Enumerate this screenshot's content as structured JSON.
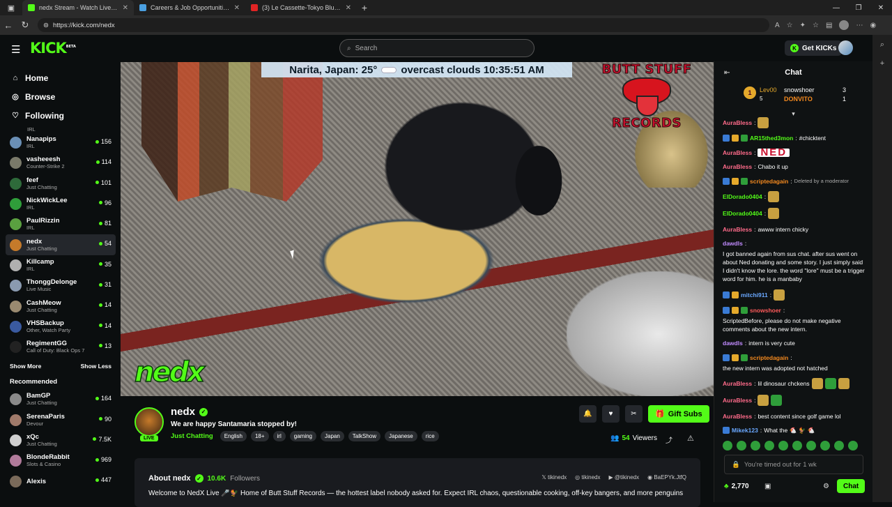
{
  "browser": {
    "tabs": [
      {
        "title": "nedx Stream - Watch Live on Kick",
        "active": true,
        "color": "#53fc18"
      },
      {
        "title": "Careers & Job Opportunities - Ear",
        "active": false,
        "color": "#4a9fe0"
      },
      {
        "title": "(3) Le Cassette-Tokyo Blues - You",
        "active": false,
        "color": "#e02424"
      }
    ],
    "url": "https://kick.com/nedx"
  },
  "header": {
    "logo": "KICK",
    "logo_sup": "BETA",
    "search_placeholder": "Search",
    "get_kicks": "Get KICKs"
  },
  "sidebar": {
    "nav": [
      {
        "label": "Home",
        "icon": "home-icon"
      },
      {
        "label": "Browse",
        "icon": "compass-icon"
      },
      {
        "label": "Following",
        "icon": "heart-icon"
      }
    ],
    "partial_category": "IRL",
    "following": [
      {
        "name": "Nanapips",
        "category": "IRL",
        "viewers": "156",
        "color": "#6a8fb5"
      },
      {
        "name": "vasheeesh",
        "category": "Counter-Strike 2",
        "viewers": "114",
        "color": "#7a7a6a"
      },
      {
        "name": "feef",
        "category": "Just Chatting",
        "viewers": "101",
        "color": "#2e6a3a"
      },
      {
        "name": "NickWickLee",
        "category": "IRL",
        "viewers": "96",
        "color": "#2f9e3a"
      },
      {
        "name": "PaulRizzin",
        "category": "IRL",
        "viewers": "81",
        "color": "#5aa040"
      },
      {
        "name": "nedx",
        "category": "Just Chatting",
        "viewers": "54",
        "color": "#c57a2a",
        "selected": true
      },
      {
        "name": "Killcamp",
        "category": "IRL",
        "viewers": "35",
        "color": "#b0b0b0"
      },
      {
        "name": "ThonggDelonge",
        "category": "Live Music",
        "viewers": "31",
        "color": "#8a9ab0"
      },
      {
        "name": "CashMeow",
        "category": "Just Chatting",
        "viewers": "14",
        "color": "#9a8a70"
      },
      {
        "name": "VHSBackup",
        "category": "Other, Watch Party",
        "viewers": "14",
        "color": "#3a5aa0"
      },
      {
        "name": "RegimentGG",
        "category": "Call of Duty: Black Ops 7",
        "viewers": "13",
        "color": "#222222"
      }
    ],
    "show_more": "Show More",
    "show_less": "Show Less",
    "recommended_label": "Recommended",
    "recommended": [
      {
        "name": "BamGP",
        "category": "Just Chatting",
        "viewers": "164",
        "color": "#8a8a8a"
      },
      {
        "name": "SerenaParis",
        "category": "Devour",
        "viewers": "90",
        "color": "#a07a6a"
      },
      {
        "name": "xQc",
        "category": "Just Chatting",
        "viewers": "7.5K",
        "color": "#cfcfcf"
      },
      {
        "name": "BlondeRabbit",
        "category": "Slots & Casino",
        "viewers": "969",
        "color": "#b07a9a"
      },
      {
        "name": "Alexis",
        "category": "",
        "viewers": "447",
        "color": "#7a6a5a"
      }
    ]
  },
  "video": {
    "weather": "Narita, Japan: 25°",
    "weather2": "overcast clouds 10:35:51 AM",
    "overlay_top": "BUTT STUFF",
    "overlay_bottom": "RECORDS",
    "watermark": "nedx"
  },
  "channel": {
    "name": "nedx",
    "live": "LIVE",
    "title": "We are happy Santamaria stopped by!",
    "category": "Just Chatting",
    "tags": [
      "English",
      "18+",
      "irl",
      "gaming",
      "Japan",
      "TalkShow",
      "Japanese",
      "rice"
    ],
    "gift_subs": "Gift Subs",
    "viewers": "54",
    "viewers_label": "Viewers"
  },
  "about": {
    "title": "About nedx",
    "followers": "10.6K",
    "followers_label": "Followers",
    "socials": [
      "tikinedx",
      "tikinedx",
      "@tikinedx",
      "BaEPYk.JtfQ"
    ],
    "description": "Welcome to NedX Live 🎤🐓 Home of Butt Stuff Records — the hottest label nobody asked for. Expect IRL chaos, questionable cooking, off-key bangers, and more penguins"
  },
  "chat": {
    "title": "Chat",
    "leaderboard": {
      "first_name": "Lev00",
      "first_count": "5",
      "second_name": "snowshoer",
      "second_count": "3",
      "third_name": "DONVITO",
      "third_count": "1"
    },
    "messages": [
      {
        "user": "AuraBless",
        "color": "#ff6b8a",
        "text": "",
        "emotes": 1
      },
      {
        "user": "AR15thed3mon",
        "color": "#53fc18",
        "text": "#chicktent",
        "badges": 3
      },
      {
        "user": "AuraBless",
        "color": "#ff6b8a",
        "text": "NED",
        "big": true
      },
      {
        "user": "AuraBless",
        "color": "#ff6b8a",
        "text": "Chabo it up"
      },
      {
        "user": "scriptedagain",
        "color": "#f58a1f",
        "text": "Deleted by a moderator",
        "deleted": true,
        "badges": 3
      },
      {
        "user": "ElDorado0404",
        "color": "#53fc18",
        "text": "",
        "emotes": 1
      },
      {
        "user": "ElDorado0404",
        "color": "#53fc18",
        "text": "",
        "emotes": 1
      },
      {
        "user": "AuraBless",
        "color": "#ff6b8a",
        "text": "awww intern chicky"
      },
      {
        "user": "dawdls",
        "color": "#c18bff",
        "text": "I got banned again from sus chat. after sus went on about Ned donating and some story. I just simply said I didn't know the lore. the word \"lore\" must be a trigger word for him. he is a manbaby"
      },
      {
        "user": "mitchi911",
        "color": "#6aa8ff",
        "text": "",
        "emotes": 1,
        "badges": 2
      },
      {
        "user": "snowshoer",
        "color": "#ff5a5a",
        "text": "ScriptedBefore, please do not make negative comments about the new intern.",
        "badges": 3
      },
      {
        "user": "dawdls",
        "color": "#c18bff",
        "text": "intern is very cute"
      },
      {
        "user": "scriptedagain",
        "color": "#f58a1f",
        "text": "the new intern was adopted not hatched",
        "badges": 3
      },
      {
        "user": "AuraBless",
        "color": "#ff6b8a",
        "text": "lil dinosaur chckens",
        "emotes": 3
      },
      {
        "user": "AuraBless",
        "color": "#ff6b8a",
        "text": "",
        "emotes": 2
      },
      {
        "user": "AuraBless",
        "color": "#ff6b8a",
        "text": "best content since golf game lol"
      },
      {
        "user": "Mikek123",
        "color": "#6aa8ff",
        "text": "What the 🐔 🐓 🐔",
        "badges": 1
      }
    ],
    "timed_out": "You're timed out for 1 wk",
    "points": "2,770",
    "chat_button": "Chat"
  }
}
